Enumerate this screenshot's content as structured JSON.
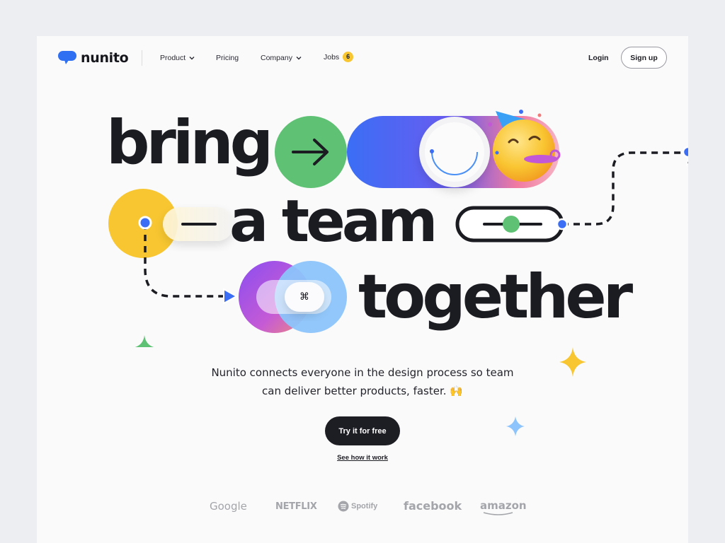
{
  "brand": {
    "name": "nunito",
    "accent": "#2f6ff2"
  },
  "nav": {
    "items": [
      {
        "label": "Product",
        "dropdown": true
      },
      {
        "label": "Pricing",
        "dropdown": false
      },
      {
        "label": "Company",
        "dropdown": true
      },
      {
        "label": "Jobs",
        "badge": "6"
      }
    ],
    "login": "Login",
    "signup": "Sign up"
  },
  "hero": {
    "line1": "bring",
    "line2": "a team",
    "line3": "together",
    "command_key": "⌘",
    "subtitle_line1": "Nunito connects everyone in the design process so team",
    "subtitle_line2": "can deliver better products, faster. 🙌",
    "cta": "Try it for free",
    "secondary_link": "See how it work"
  },
  "logos": [
    "Google",
    "NETFLIX",
    "Spotify",
    "facebook",
    "amazon"
  ],
  "colors": {
    "green": "#5fc174",
    "yellow": "#f7c630",
    "blue": "#3b6ef5",
    "dark": "#1b1b22",
    "light_blue": "#8cc4fb"
  }
}
